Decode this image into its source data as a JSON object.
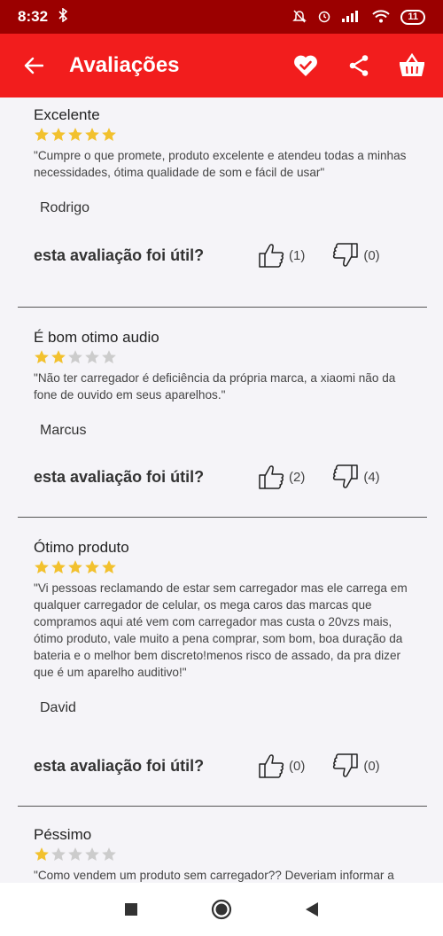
{
  "status_bar": {
    "time": "8:32",
    "battery": "11"
  },
  "app_bar": {
    "title": "Avaliações"
  },
  "helpful_label": "esta avaliação foi útil?",
  "colors": {
    "app_bar": "#f21d1d",
    "status_bar": "#9b0000",
    "star_filled": "#f2c12e",
    "star_empty": "#cccccc"
  },
  "reviews": [
    {
      "title": "Excelente",
      "rating": 5,
      "text": "\"Cumpre o que promete, produto excelente e atendeu todas a minhas necessidades, ótima qualidade de som e fácil de usar\"",
      "author": "Rodrigo",
      "up": "(1)",
      "down": "(0)"
    },
    {
      "title": "É bom otimo audio",
      "rating": 2,
      "text": "\"Não ter carregador é deficiência da própria marca, a xiaomi não da fone de ouvido em seus aparelhos.\"",
      "author": "Marcus",
      "up": "(2)",
      "down": "(4)"
    },
    {
      "title": "Ótimo produto",
      "rating": 5,
      "text": "\"Vi pessoas reclamando de estar sem carregador mas ele carrega em qualquer carregador de celular, os mega caros das marcas que compramos aqui até vem com carregador mas custa o 20vzs mais, ótimo produto, vale muito a pena comprar, som bom, boa duração da bateria e o melhor bem discreto!menos risco de assado, da pra dizer que é um aparelho auditivo!\"",
      "author": "David",
      "up": "(0)",
      "down": "(0)"
    },
    {
      "title": "Péssimo",
      "rating": 1,
      "text": "\"Como vendem um produto sem carregador?? Deveriam informar a necessidade de adiquir o acessório a parte.\"",
      "author": "",
      "up": "",
      "down": ""
    }
  ]
}
